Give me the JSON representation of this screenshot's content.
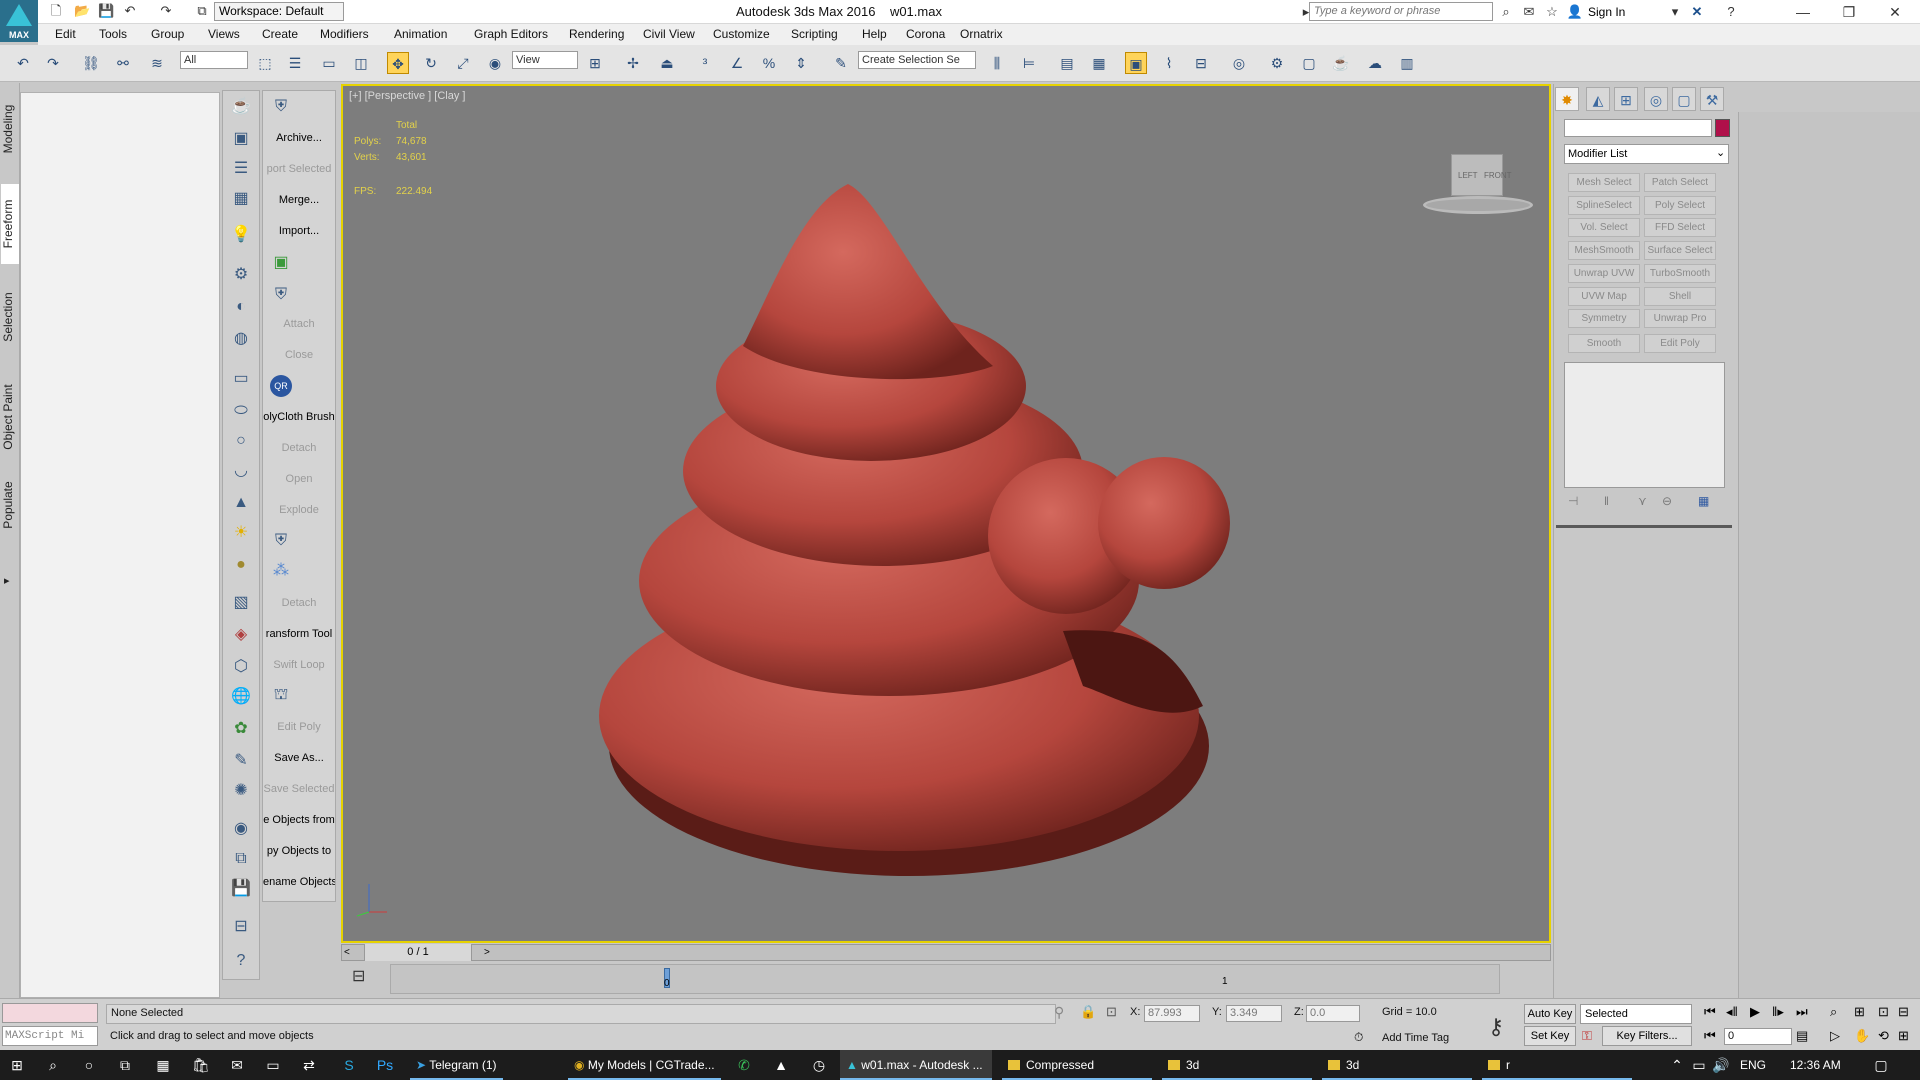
{
  "titlebar": {
    "logo_text": "MAX",
    "workspace": "Workspace: Default",
    "app_title": "Autodesk 3ds Max 2016",
    "file_name": "w01.max",
    "search_placeholder": "Type a keyword or phrase",
    "sign_in": "Sign In"
  },
  "menu": [
    "Edit",
    "Tools",
    "Group",
    "Views",
    "Create",
    "Modifiers",
    "Animation",
    "Graph Editors",
    "Rendering",
    "Civil View",
    "Customize",
    "Scripting",
    "Help",
    "Corona",
    "Ornatrix"
  ],
  "toolbar": {
    "filter_value": "All",
    "refcoord_value": "View",
    "selection_set_placeholder": "Create Selection Se"
  },
  "ribbon_tabs": [
    "Modeling",
    "Freeform",
    "Selection",
    "Object Paint",
    "Populate"
  ],
  "command_column": [
    {
      "label": "Archive...",
      "enabled": true
    },
    {
      "label": "port Selected",
      "enabled": false
    },
    {
      "label": "Merge...",
      "enabled": true
    },
    {
      "label": "Import...",
      "enabled": true
    },
    {
      "label": "Attach",
      "enabled": false
    },
    {
      "label": "Close",
      "enabled": false
    },
    {
      "label": "olyCloth Brush",
      "enabled": true
    },
    {
      "label": "Detach",
      "enabled": false
    },
    {
      "label": "Open",
      "enabled": false
    },
    {
      "label": "Explode",
      "enabled": false
    },
    {
      "label": "Detach",
      "enabled": false
    },
    {
      "label": "ransform Tool",
      "enabled": true
    },
    {
      "label": "Swift Loop",
      "enabled": false
    },
    {
      "label": "Edit Poly",
      "enabled": false
    },
    {
      "label": "Save As...",
      "enabled": true
    },
    {
      "label": "Save Selected",
      "enabled": false
    },
    {
      "label": "e Objects from",
      "enabled": true
    },
    {
      "label": "py Objects to",
      "enabled": true
    },
    {
      "label": "ename Objects",
      "enabled": true
    }
  ],
  "viewport": {
    "label": "[+] [Perspective ] [Clay ]",
    "stats": {
      "total_label": "Total",
      "polys_label": "Polys:",
      "polys": "74,678",
      "verts_label": "Verts:",
      "verts": "43,601",
      "fps_label": "FPS:",
      "fps": "222.494"
    },
    "viewcube": {
      "left": "LEFT",
      "front": "FRONT"
    },
    "model_color": "#b5463d",
    "background_color": "#7d7d7d",
    "border_color": "#e6d200"
  },
  "command_panel": {
    "modifier_list": "Modifier List",
    "swatch_color": "#b0104a",
    "modifiers": [
      "Mesh Select",
      "Patch Select",
      "SplineSelect",
      "Poly Select",
      "Vol. Select",
      "FFD Select",
      "MeshSmooth",
      "Surface Select",
      "Unwrap UVW",
      "TurboSmooth",
      "UVW Map",
      "Shell",
      "Symmetry",
      "Unwrap Pro",
      "Smooth",
      "Edit Poly"
    ]
  },
  "timeline": {
    "time_slider": "0 / 1",
    "marker_0": "0",
    "marker_1": "1"
  },
  "status": {
    "selection": "None Selected",
    "prompt": "Click and drag to select and move objects",
    "maxscript": "MAXScript Mi",
    "x_label": "X:",
    "x": "87.993",
    "y_label": "Y:",
    "y": "3.349",
    "z_label": "Z:",
    "z": "0.0",
    "grid": "Grid = 10.0",
    "add_time_tag": "Add Time Tag",
    "auto_key": "Auto Key",
    "set_key": "Set Key",
    "selected": "Selected",
    "key_filters": "Key Filters...",
    "frame": "0"
  },
  "taskbar": {
    "apps": [
      {
        "label": "Telegram (1)",
        "active": false
      },
      {
        "label": "My Models | CGTrade...",
        "active": false
      },
      {
        "label": "w01.max - Autodesk ...",
        "active": true
      },
      {
        "label": "Compressed",
        "active": false
      },
      {
        "label": "3d",
        "active": false
      },
      {
        "label": "3d",
        "active": false
      },
      {
        "label": "r",
        "active": false
      }
    ],
    "lang": "ENG",
    "time": "12:36 AM"
  }
}
